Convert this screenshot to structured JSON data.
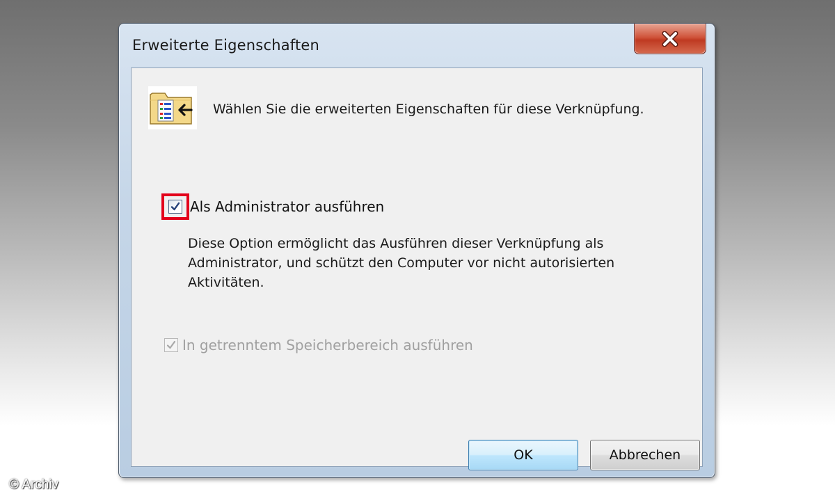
{
  "dialog": {
    "title": "Erweiterte Eigenschaften",
    "close_icon": "close-icon",
    "header_icon": "shortcut-properties-icon",
    "header_text": "Wählen Sie die erweiterten Eigenschaften für diese Verknüpfung.",
    "options": {
      "run_as_admin": {
        "label": "Als Administrator ausführen",
        "checked": true,
        "enabled": true,
        "description": "Diese Option ermöglicht das Ausführen dieser Verknüpfung als Administrator, und schützt den Computer vor nicht autorisierten Aktivitäten."
      },
      "separate_memory": {
        "label": "In getrenntem Speicherbereich ausführen",
        "checked": true,
        "enabled": false
      }
    },
    "buttons": {
      "ok_label": "OK",
      "cancel_label": "Abbrechen"
    }
  },
  "watermark": "© Archiv",
  "colors": {
    "highlight": "#e3001b",
    "close_button": "#c8452c",
    "ok_button_border": "#3c7fb1"
  }
}
